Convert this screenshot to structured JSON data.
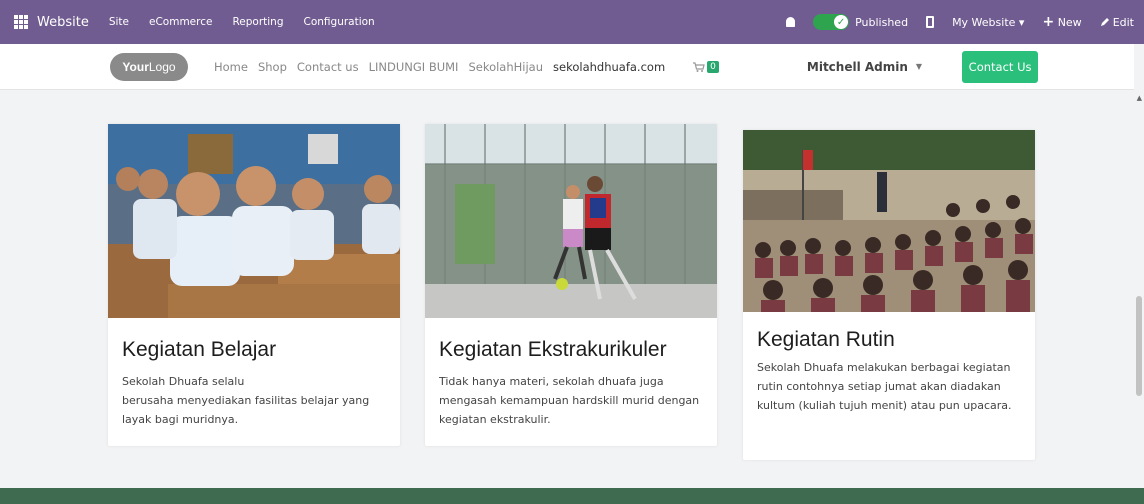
{
  "topbar": {
    "brand": "Website",
    "menu": [
      "Site",
      "eCommerce",
      "Reporting",
      "Configuration"
    ],
    "published_label": "Published",
    "my_website": "My Website",
    "new_label": "New",
    "edit_label": "Edit"
  },
  "nav": {
    "logo_bold": "Your",
    "logo_rest": "Logo",
    "links": [
      "Home",
      "Shop",
      "Contact us",
      "LINDUNGI BUMI",
      "SekolahHijau",
      "sekolahdhuafa.com"
    ],
    "cart_count": "0",
    "user": "Mitchell Admin",
    "contact_button": "Contact Us"
  },
  "cards": [
    {
      "title": "Kegiatan Belajar",
      "text_line1": "Sekolah Dhuafa selalu",
      "text_line2": "berusaha menyediakan fasilitas belajar yang layak bagi muridnya."
    },
    {
      "title": "Kegiatan Ekstrakurikuler",
      "text": "Tidak hanya materi, sekolah dhuafa juga mengasah kemampuan hardskill murid dengan kegiatan ekstrakulir."
    },
    {
      "title": "Kegiatan Rutin",
      "text": "Sekolah Dhuafa melakukan berbagai kegiatan rutin contohnya setiap jumat akan diadakan kultum (kuliah tujuh menit) atau pun upacara."
    }
  ],
  "colors": {
    "topbar": "#705c90",
    "accent_green": "#2bbf7c",
    "footer": "#3f6b50"
  }
}
